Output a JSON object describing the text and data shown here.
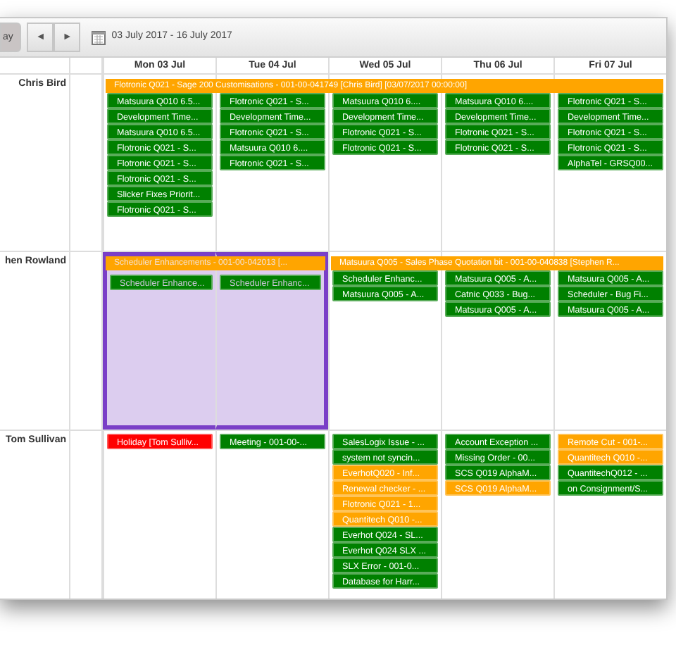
{
  "toolbar": {
    "view_button": "ay",
    "prev_button": "◄",
    "next_button": "►",
    "date_range": "03 July 2017 - 16 July 2017"
  },
  "days": [
    "Mon 03 Jul",
    "Tue 04 Jul",
    "Wed 05 Jul",
    "Thu 06 Jul",
    "Fri 07 Jul"
  ],
  "resources": [
    {
      "name": "Chris Bird",
      "cells": [
        {
          "selected": false,
          "covered_by_banner": true,
          "banner": {
            "text": "Flotronic Q021 - Sage 200 Customisations - 001-00-041749 [Chris Bird] [03/07/2017 00:00:00]",
            "color": "#ffa500"
          },
          "events": [
            {
              "text": "Matsuura Q010 6.5...",
              "color": "#008000"
            },
            {
              "text": "Development Time...",
              "color": "#008000"
            },
            {
              "text": "Matsuura Q010 6.5...",
              "color": "#008000"
            },
            {
              "text": "Flotronic Q021 - S...",
              "color": "#008000"
            },
            {
              "text": "Flotronic Q021 - S...",
              "color": "#008000"
            },
            {
              "text": "Flotronic Q021 - S...",
              "color": "#008000"
            },
            {
              "text": "Slicker Fixes Priorit...",
              "color": "#008000"
            },
            {
              "text": "Flotronic Q021 - S...",
              "color": "#008000"
            }
          ]
        },
        {
          "selected": false,
          "covered_by_banner": true,
          "events": [
            {
              "text": "Flotronic Q021 - S...",
              "color": "#008000"
            },
            {
              "text": "Development Time...",
              "color": "#008000"
            },
            {
              "text": "Flotronic Q021 - S...",
              "color": "#008000"
            },
            {
              "text": "Matsuura Q010 6....",
              "color": "#008000"
            },
            {
              "text": "Flotronic Q021 - S...",
              "color": "#008000"
            }
          ]
        },
        {
          "selected": false,
          "covered_by_banner": true,
          "events": [
            {
              "text": "Matsuura Q010 6....",
              "color": "#008000"
            },
            {
              "text": "Development Time...",
              "color": "#008000"
            },
            {
              "text": "Flotronic Q021 - S...",
              "color": "#008000"
            },
            {
              "text": "Flotronic Q021 - S...",
              "color": "#008000"
            }
          ]
        },
        {
          "selected": false,
          "covered_by_banner": true,
          "events": [
            {
              "text": "Matsuura Q010 6....",
              "color": "#008000"
            },
            {
              "text": "Development Time...",
              "color": "#008000"
            },
            {
              "text": "Flotronic Q021 - S...",
              "color": "#008000"
            },
            {
              "text": "Flotronic Q021 - S...",
              "color": "#008000"
            }
          ]
        },
        {
          "selected": false,
          "covered_by_banner": true,
          "events": [
            {
              "text": "Flotronic Q021 - S...",
              "color": "#008000"
            },
            {
              "text": "Development Time...",
              "color": "#008000"
            },
            {
              "text": "Flotronic Q021 - S...",
              "color": "#008000"
            },
            {
              "text": "Flotronic Q021 - S...",
              "color": "#008000"
            },
            {
              "text": "AlphaTel - GRSQ00...",
              "color": "#008000"
            }
          ]
        }
      ]
    },
    {
      "name": "hen Rowland",
      "cells": [
        {
          "selected": true,
          "covered_by_banner": true,
          "banner": {
            "text": "Scheduler Enhancements - 001-00-042013 [...",
            "color": "#ffa500"
          },
          "events": [
            {
              "text": "Scheduler Enhance...",
              "color": "#008000"
            }
          ]
        },
        {
          "selected": true,
          "covered_by_banner": true,
          "events": [
            {
              "text": "Scheduler Enhanc...",
              "color": "#008000"
            }
          ]
        },
        {
          "selected": false,
          "covered_by_banner": true,
          "banner": {
            "text": "Matsuura Q005 - Sales Phase Quotation bit - 001-00-040838 [Stephen R...",
            "color": "#ffa500"
          },
          "events": [
            {
              "text": "Scheduler Enhanc...",
              "color": "#008000"
            },
            {
              "text": "Matsuura Q005 - A...",
              "color": "#008000"
            }
          ]
        },
        {
          "selected": false,
          "covered_by_banner": true,
          "events": [
            {
              "text": "Matsuura Q005 - A...",
              "color": "#008000"
            },
            {
              "text": "Catnic Q033 - Bug...",
              "color": "#008000"
            },
            {
              "text": "Matsuura Q005 - A...",
              "color": "#008000"
            }
          ]
        },
        {
          "selected": false,
          "covered_by_banner": true,
          "events": [
            {
              "text": "Matsuura Q005 - A...",
              "color": "#008000"
            },
            {
              "text": "Scheduler - Bug Fi...",
              "color": "#008000"
            },
            {
              "text": "Matsuura Q005 - A...",
              "color": "#008000"
            }
          ]
        }
      ]
    },
    {
      "name": "Tom Sullivan",
      "cells": [
        {
          "selected": false,
          "covered_by_banner": false,
          "events": [
            {
              "text": "Holiday [Tom Sulliv...",
              "color": "#ff0000"
            }
          ]
        },
        {
          "selected": false,
          "covered_by_banner": false,
          "events": [
            {
              "text": "Meeting - 001-00-...",
              "color": "#008000"
            }
          ]
        },
        {
          "selected": false,
          "covered_by_banner": false,
          "events": [
            {
              "text": "SalesLogix Issue - ...",
              "color": "#008000"
            },
            {
              "text": "system not syncin...",
              "color": "#008000"
            },
            {
              "text": "EverhotQ020 - Inf...",
              "color": "#ffa500"
            },
            {
              "text": "Renewal checker - ...",
              "color": "#ffa500"
            },
            {
              "text": "Flotronic Q021 - 1...",
              "color": "#ffa500"
            },
            {
              "text": "Quantitech Q010 -...",
              "color": "#ffa500"
            },
            {
              "text": "Everhot Q024 - SL...",
              "color": "#008000"
            },
            {
              "text": "Everhot Q024 SLX ...",
              "color": "#008000"
            },
            {
              "text": "SLX Error - 001-0...",
              "color": "#008000"
            },
            {
              "text": "Database for Harr...",
              "color": "#008000"
            }
          ]
        },
        {
          "selected": false,
          "covered_by_banner": false,
          "events": [
            {
              "text": "Account Exception ...",
              "color": "#008000"
            },
            {
              "text": "Missing Order - 00...",
              "color": "#008000"
            },
            {
              "text": "SCS Q019 AlphaM...",
              "color": "#008000"
            },
            {
              "text": "SCS Q019 AlphaM...",
              "color": "#ffa500"
            }
          ]
        },
        {
          "selected": false,
          "covered_by_banner": false,
          "events": [
            {
              "text": "Remote Cut - 001-...",
              "color": "#ffa500"
            },
            {
              "text": "Quantitech Q010 -...",
              "color": "#ffa500"
            },
            {
              "text": "QuantitechQ012 - ...",
              "color": "#008000"
            },
            {
              "text": "on Consignment/S...",
              "color": "#008000"
            }
          ]
        }
      ]
    }
  ]
}
